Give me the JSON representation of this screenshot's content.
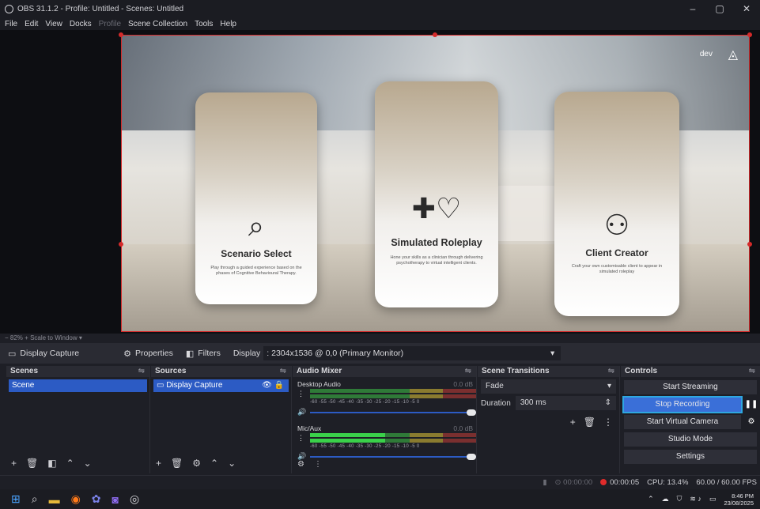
{
  "titlebar": {
    "title": "OBS 31.1.2 - Profile: Untitled - Scenes: Untitled",
    "minimize": "–",
    "maximize": "▢",
    "close": "✕"
  },
  "menubar": {
    "items": [
      "File",
      "Edit",
      "View",
      "Docks",
      "Profile",
      "Scene Collection",
      "Tools",
      "Help"
    ]
  },
  "preview": {
    "dev_label": "dev",
    "cards": [
      {
        "title": "Scenario Select",
        "desc": "Play through a guided experience based on the phases of Cognitive Behavioural Therapy."
      },
      {
        "title": "Simulated Roleplay",
        "desc": "Hone your skills as a clinician through delivering psychotherapy to virtual intelligent clients."
      },
      {
        "title": "Client Creator",
        "desc": "Craft your own customisable client to appear in simulated roleplay"
      }
    ]
  },
  "zoombar": {
    "zoom": "82%",
    "plus": "+",
    "mode": "Scale to Window"
  },
  "sourcebar": {
    "source": "Display Capture",
    "properties": "Properties",
    "filters": "Filters",
    "display_label": "Display",
    "display_value": ": 2304x1536 @ 0,0 (Primary Monitor)"
  },
  "scenes": {
    "title": "Scenes",
    "items": [
      "Scene"
    ]
  },
  "sources": {
    "title": "Sources",
    "items": [
      "Display Capture"
    ]
  },
  "mixer": {
    "title": "Audio Mixer",
    "channels": [
      {
        "name": "Desktop Audio",
        "db": "0.0 dB",
        "level": 0.0
      },
      {
        "name": "Mic/Aux",
        "db": "0.0 dB",
        "level": 0.45
      }
    ],
    "scale": "-60 -55 -50 -45 -40 -35 -30 -25 -20 -15 -10 -5 0"
  },
  "transitions": {
    "title": "Scene Transitions",
    "type": "Fade",
    "duration_label": "Duration",
    "duration_value": "300 ms"
  },
  "controls": {
    "title": "Controls",
    "buttons": [
      "Start Streaming",
      "Stop Recording",
      "Start Virtual Camera",
      "Studio Mode",
      "Settings"
    ]
  },
  "status": {
    "stream_time": "00:00:00",
    "rec_time": "00:00:05",
    "cpu": "CPU: 13.4%",
    "fps": "60.00 / 60.00 FPS"
  },
  "taskbar": {
    "time": "8:46 PM",
    "date": "23/08/2025"
  }
}
